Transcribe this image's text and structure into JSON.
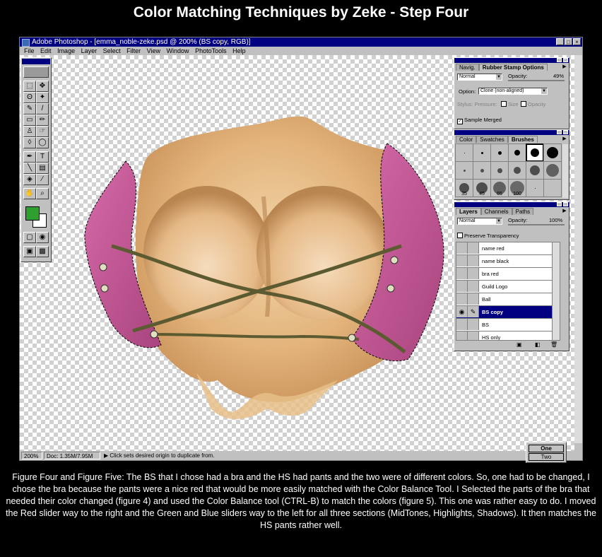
{
  "page_title": "Color Matching Techniques by Zeke - Step Four",
  "window": {
    "title": "Adobe Photoshop - [emma_noble-zeke.psd @ 200% (BS copy, RGB)]",
    "buttons": [
      "_",
      "□",
      "×"
    ]
  },
  "menu": [
    "File",
    "Edit",
    "Image",
    "Layer",
    "Select",
    "Filter",
    "View",
    "Window",
    "PhotoTools",
    "Help"
  ],
  "status": {
    "zoom": "200%",
    "doc": "Doc: 1.35M/7.95M",
    "hint": "Click sets desired origin to duplicate from."
  },
  "rubber_stamp": {
    "tabs": [
      "Navig.",
      "Rubber Stamp Options"
    ],
    "mode": "Normal",
    "opacity_label": "Opacity:",
    "opacity_value": "49%",
    "option_label": "Option:",
    "option_value": "Clone (non-aligned)",
    "stylus_label": "Stylus: Pressure:",
    "size_label": "Size",
    "opacity_check_label": "Opacity",
    "sample_merged": "Sample Merged"
  },
  "brushes": {
    "tabs": [
      "Color",
      "Swatches",
      "Brushes"
    ],
    "sizes": [
      "35",
      "45",
      "65",
      "100"
    ]
  },
  "layers": {
    "tabs": [
      "Layers",
      "Channels",
      "Paths"
    ],
    "mode": "Normal",
    "opacity_label": "Opacity:",
    "opacity_value": "100%",
    "preserve": "Preserve Transparency",
    "items": [
      "name red",
      "name black",
      "bra red",
      "Guild Logo",
      "Ball",
      "BS copy",
      "BS",
      "HS only"
    ],
    "selected_index": 5
  },
  "one_two": {
    "one": "One",
    "two": "Two"
  },
  "caption": "Figure Four and Figure Five: The BS that I chose had a bra and the HS had pants and the two were of different colors. So, one had to be changed, I chose the bra because the pants were a nice red that would be more easily matched with the Color Balance Tool. I Selected the parts of the bra that needed their color changed (figure 4) and used the Color Balance tool (CTRL-B) to match the colors (figure 5). This one was rather easy to do. I moved the Red slider way to the right and the Green and Blue sliders way to the left for all three sections (MidTones, Highlights, Shadows). It then matches the HS pants rather well.",
  "colors": {
    "title_bar": "#000080",
    "foreground_swatch": "#2fa02f",
    "bra_pink": "#c45a9a",
    "skin": "#e3b47c"
  },
  "tools": [
    "marquee-icon",
    "move-icon",
    "lasso-icon",
    "magic-wand-icon",
    "airbrush-icon",
    "paintbrush-icon",
    "eraser-icon",
    "pencil-icon",
    "rubber-stamp-icon",
    "smudge-icon",
    "blur-icon",
    "dodge-icon",
    "pen-icon",
    "type-icon",
    "line-icon",
    "gradient-icon",
    "paint-bucket-icon",
    "eyedropper-icon",
    "hand-icon",
    "zoom-icon"
  ]
}
